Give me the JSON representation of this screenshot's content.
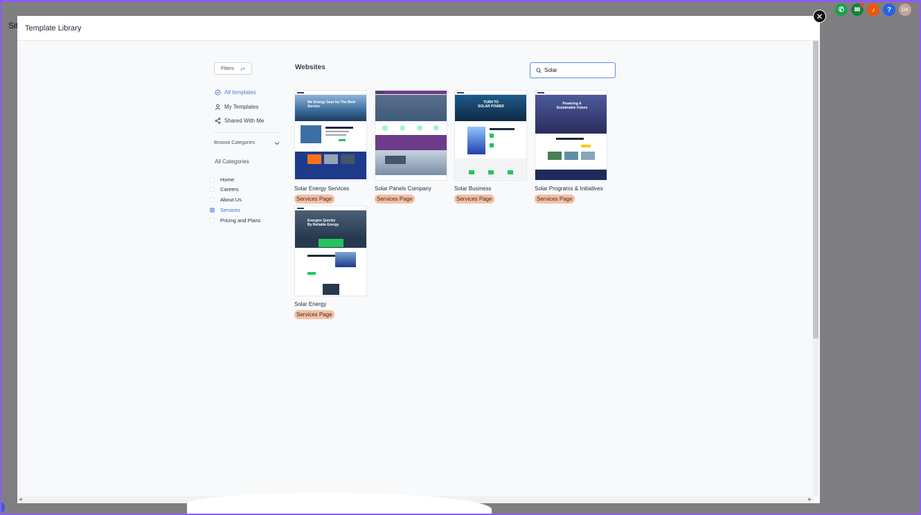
{
  "background": {
    "partial_title": "Sit"
  },
  "top_icons": [
    {
      "name": "phone-icon",
      "color": "#16a34a",
      "glyph": "✆"
    },
    {
      "name": "megaphone-icon",
      "color": "#15803d",
      "glyph": "✉"
    },
    {
      "name": "bell-icon",
      "color": "#ea580c",
      "glyph": "♪"
    },
    {
      "name": "help-icon",
      "color": "#2563eb",
      "glyph": "?"
    },
    {
      "name": "avatar",
      "color": "#c4a49a",
      "glyph": "DA"
    }
  ],
  "modal": {
    "title": "Template Library",
    "close_glyph": "✕"
  },
  "sidebar": {
    "filters_label": "Filters",
    "nav": [
      {
        "label": "All templates",
        "icon": "check-circle-icon",
        "active": true
      },
      {
        "label": "My Templates",
        "icon": "user-icon",
        "active": false
      },
      {
        "label": "Shared With Me",
        "icon": "share-icon",
        "active": false
      }
    ],
    "browse_label": "Browse Categories",
    "all_categories_label": "All Categories",
    "categories": [
      {
        "label": "Home",
        "checked": false
      },
      {
        "label": "Careers",
        "checked": false
      },
      {
        "label": "About Us",
        "checked": false
      },
      {
        "label": "Services",
        "checked": true
      },
      {
        "label": "Pricing and Plans",
        "checked": false
      }
    ]
  },
  "main": {
    "section_title": "Websites",
    "search": {
      "value": "Solar",
      "placeholder": "Search"
    },
    "templates": [
      {
        "name": "Solar Energy Services",
        "tag": "Services Page",
        "hero_text": "We Energy Gear for The Best Service",
        "theme": "#1e3a5f"
      },
      {
        "name": "Solar Panels Company",
        "tag": "Services Page",
        "hero_text": "",
        "theme": "#6d3b8a"
      },
      {
        "name": "Solar Business",
        "tag": "Services Page",
        "hero_text": "TURN TO SOLAR POWER",
        "theme": "#0f2a44"
      },
      {
        "name": "Solar Programs & Initiatives",
        "tag": "Services Page",
        "hero_text": "Powering A Sustainable Future",
        "theme": "#2a2d5c"
      },
      {
        "name": "Solar Energy",
        "tag": "Services Page",
        "hero_text": "Energize Quickly By Reliable Energy",
        "theme": "#26394f"
      }
    ]
  }
}
